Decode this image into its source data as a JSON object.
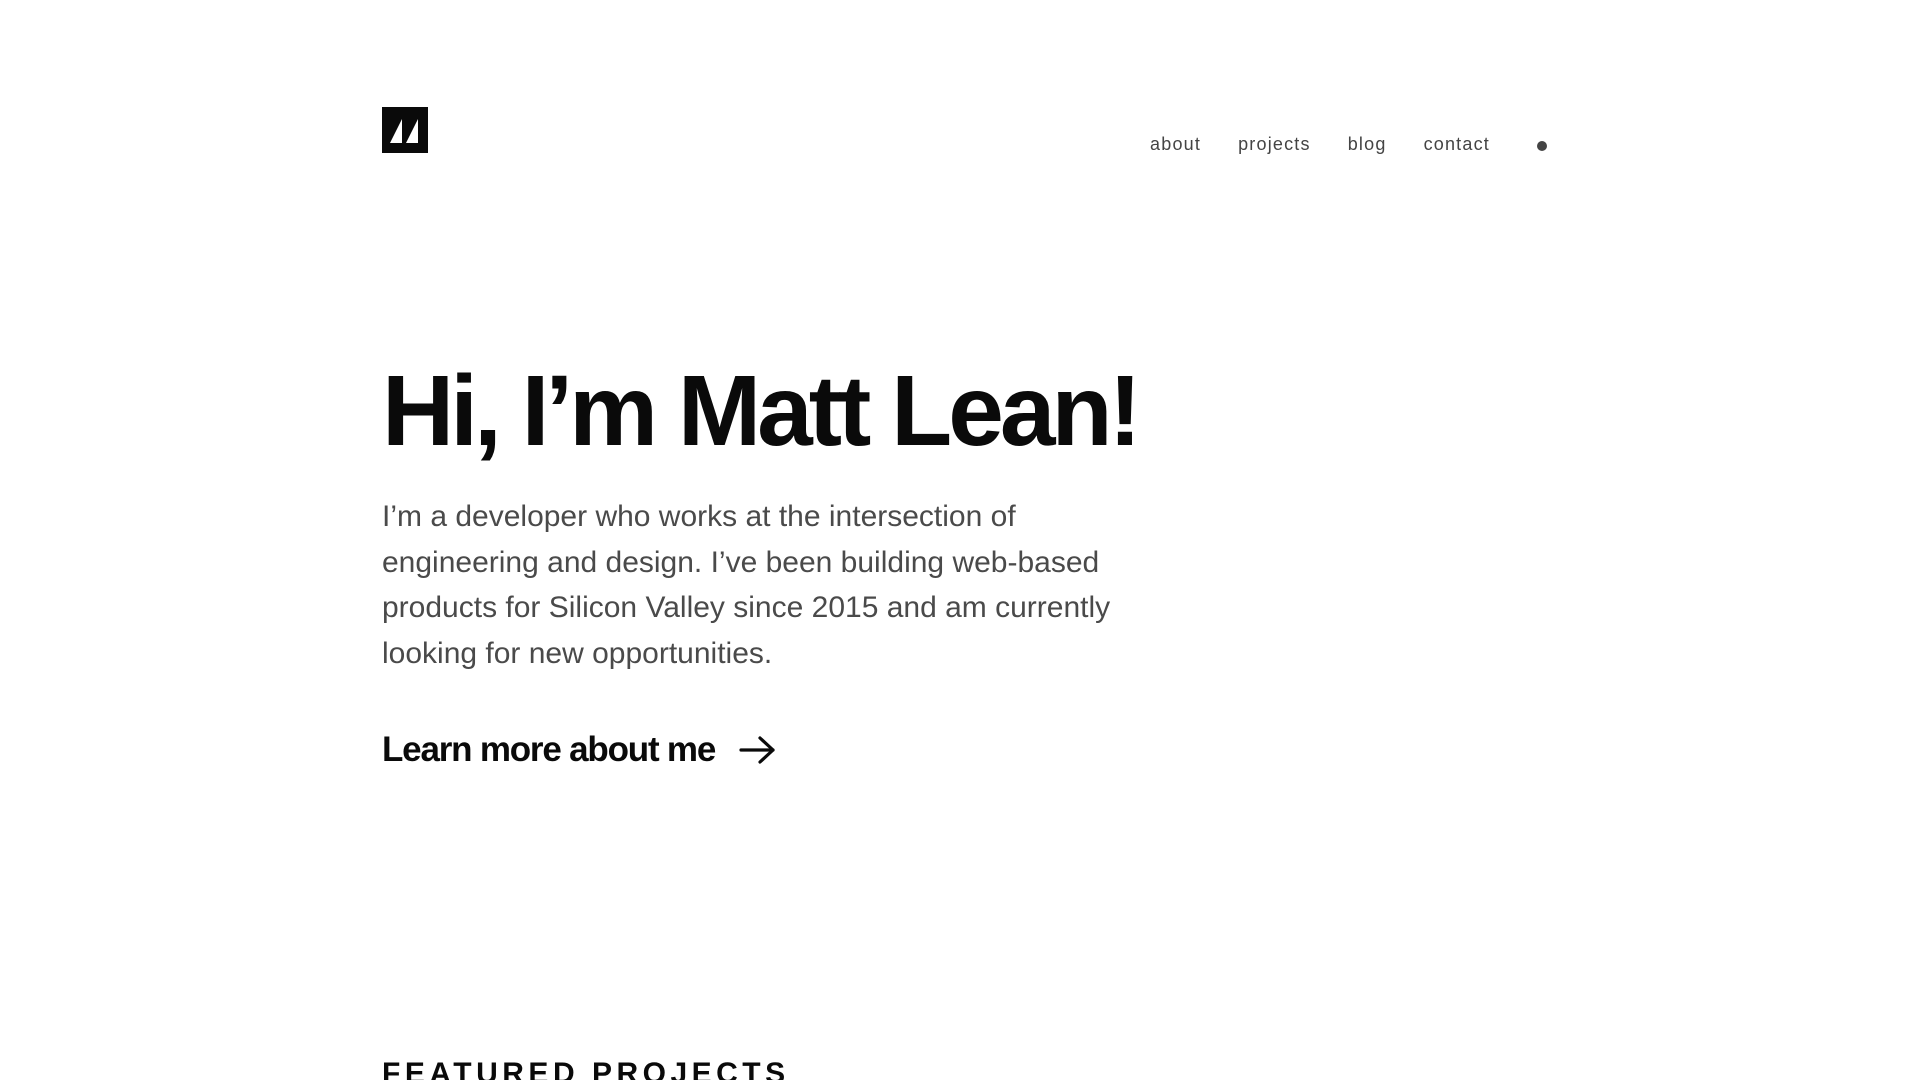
{
  "header": {
    "logo_icon": "stylized-m-logo-icon",
    "nav": {
      "items": [
        {
          "label": "about"
        },
        {
          "label": "projects"
        },
        {
          "label": "blog"
        },
        {
          "label": "contact"
        }
      ],
      "theme_toggle_icon": "dot-icon"
    }
  },
  "hero": {
    "title": "Hi, I’m Matt Lean!",
    "description": "I’m a developer who works at the intersection of engineering and design. I’ve been building web-based products for Silicon Valley since 2015 and am currently looking for new opportunities.",
    "cta": {
      "label": "Learn more about me",
      "icon": "arrow-right-icon"
    }
  },
  "featured": {
    "heading": "FEATURED PROJECTS"
  },
  "colors": {
    "text": "#0a0a0a",
    "muted_text": "#4a4a4a",
    "nav_text": "#444444",
    "background": "#ffffff"
  }
}
